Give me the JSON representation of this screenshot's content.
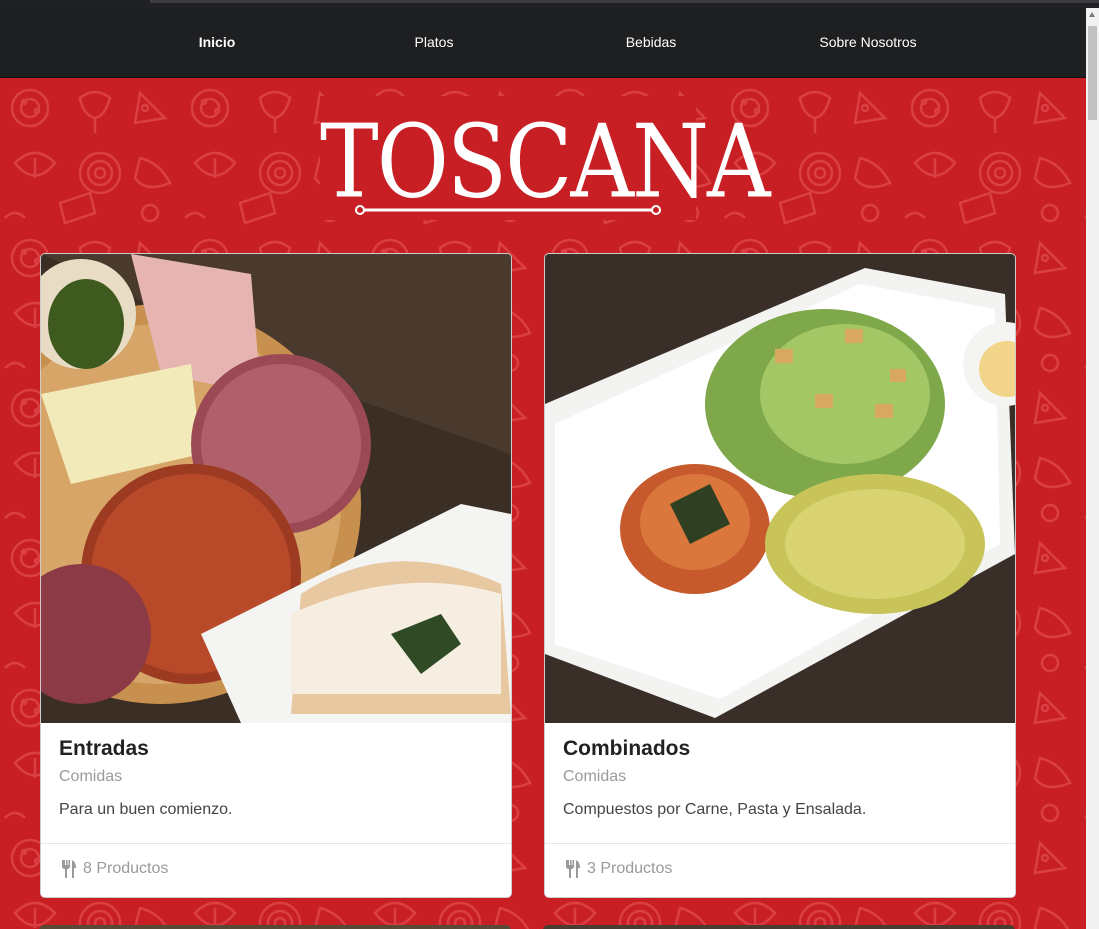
{
  "nav": {
    "items": [
      {
        "label": "Inicio",
        "active": true
      },
      {
        "label": "Platos",
        "active": false
      },
      {
        "label": "Bebidas",
        "active": false
      },
      {
        "label": "Sobre Nosotros",
        "active": false
      }
    ]
  },
  "logo": {
    "text": "TOSCANA"
  },
  "cards": [
    {
      "title": "Entradas",
      "subtitle": "Comidas",
      "description": "Para un buen comienzo.",
      "count": "8 Productos",
      "icon": "utensils-icon"
    },
    {
      "title": "Combinados",
      "subtitle": "Comidas",
      "description": "Compuestos por Carne, Pasta y Ensalada.",
      "count": "3 Productos",
      "icon": "utensils-icon"
    }
  ],
  "colors": {
    "brand_red": "#c81f24",
    "navbar": "#1e1f21",
    "text_muted": "#9a9a9a"
  }
}
